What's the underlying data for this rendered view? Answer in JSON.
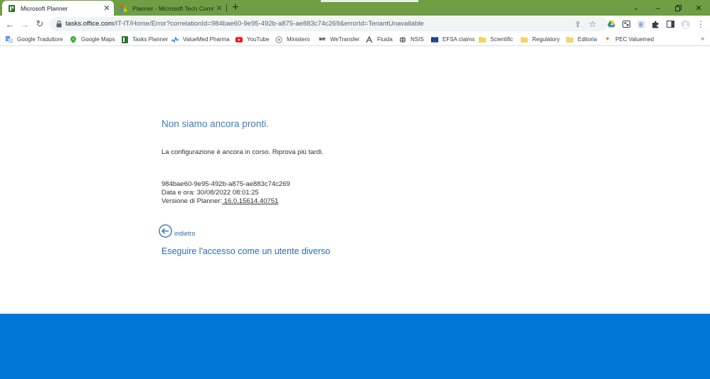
{
  "tabs": [
    {
      "title": "Microsoft Planner",
      "active": true
    },
    {
      "title": "Planner - Microsoft Tech Community",
      "active": false
    }
  ],
  "address": {
    "host": "tasks.office.com",
    "path": "/IT-IT/Home/Error?correlationId=984bae60-9e95-492b-a875-ae883c74c269&errorId=TenantUnavailable"
  },
  "bookmarks": [
    {
      "label": "Google Traduttore",
      "icon": "google-translate-icon"
    },
    {
      "label": "Google Maps",
      "icon": "maps-pin-icon"
    },
    {
      "label": "Tasks Planner",
      "icon": "planner-icon"
    },
    {
      "label": "ValueMed Pharma",
      "icon": "valuemed-icon"
    },
    {
      "label": "YouTube",
      "icon": "youtube-icon"
    },
    {
      "label": "Ministero",
      "icon": "ministero-icon"
    },
    {
      "label": "WeTransfer",
      "icon": "wetransfer-icon"
    },
    {
      "label": "Fluida",
      "icon": "fluida-icon"
    },
    {
      "label": "NSIS",
      "icon": "globe-icon"
    },
    {
      "label": "EFSA claims",
      "icon": "eu-flag-icon"
    },
    {
      "label": "Scientific",
      "icon": "folder-icon"
    },
    {
      "label": "Regulatory",
      "icon": "folder-icon"
    },
    {
      "label": "Editoria",
      "icon": "folder-icon"
    },
    {
      "label": "PEC Valuemed",
      "icon": "pec-icon"
    }
  ],
  "error": {
    "heading": "Non siamo ancora pronti.",
    "message": "La configurazione è ancora in corso. Riprova più tardi.",
    "correlation_id": "984bae60-9e95-492b-a875-ae883c74c269",
    "datetime_label": "Data e ora: 30/08/2022 08:01:25",
    "version_label": "Versione di Planner:",
    "version_value": " 16.0.15614.40751",
    "back_label": "indietro",
    "signin_other": "Eseguire l'accesso come un utente diverso"
  },
  "colors": {
    "tabstrip": "#6f9e45",
    "heading": "#3c7dc4",
    "link": "#2b6cb3",
    "footer": "#0078d7"
  }
}
